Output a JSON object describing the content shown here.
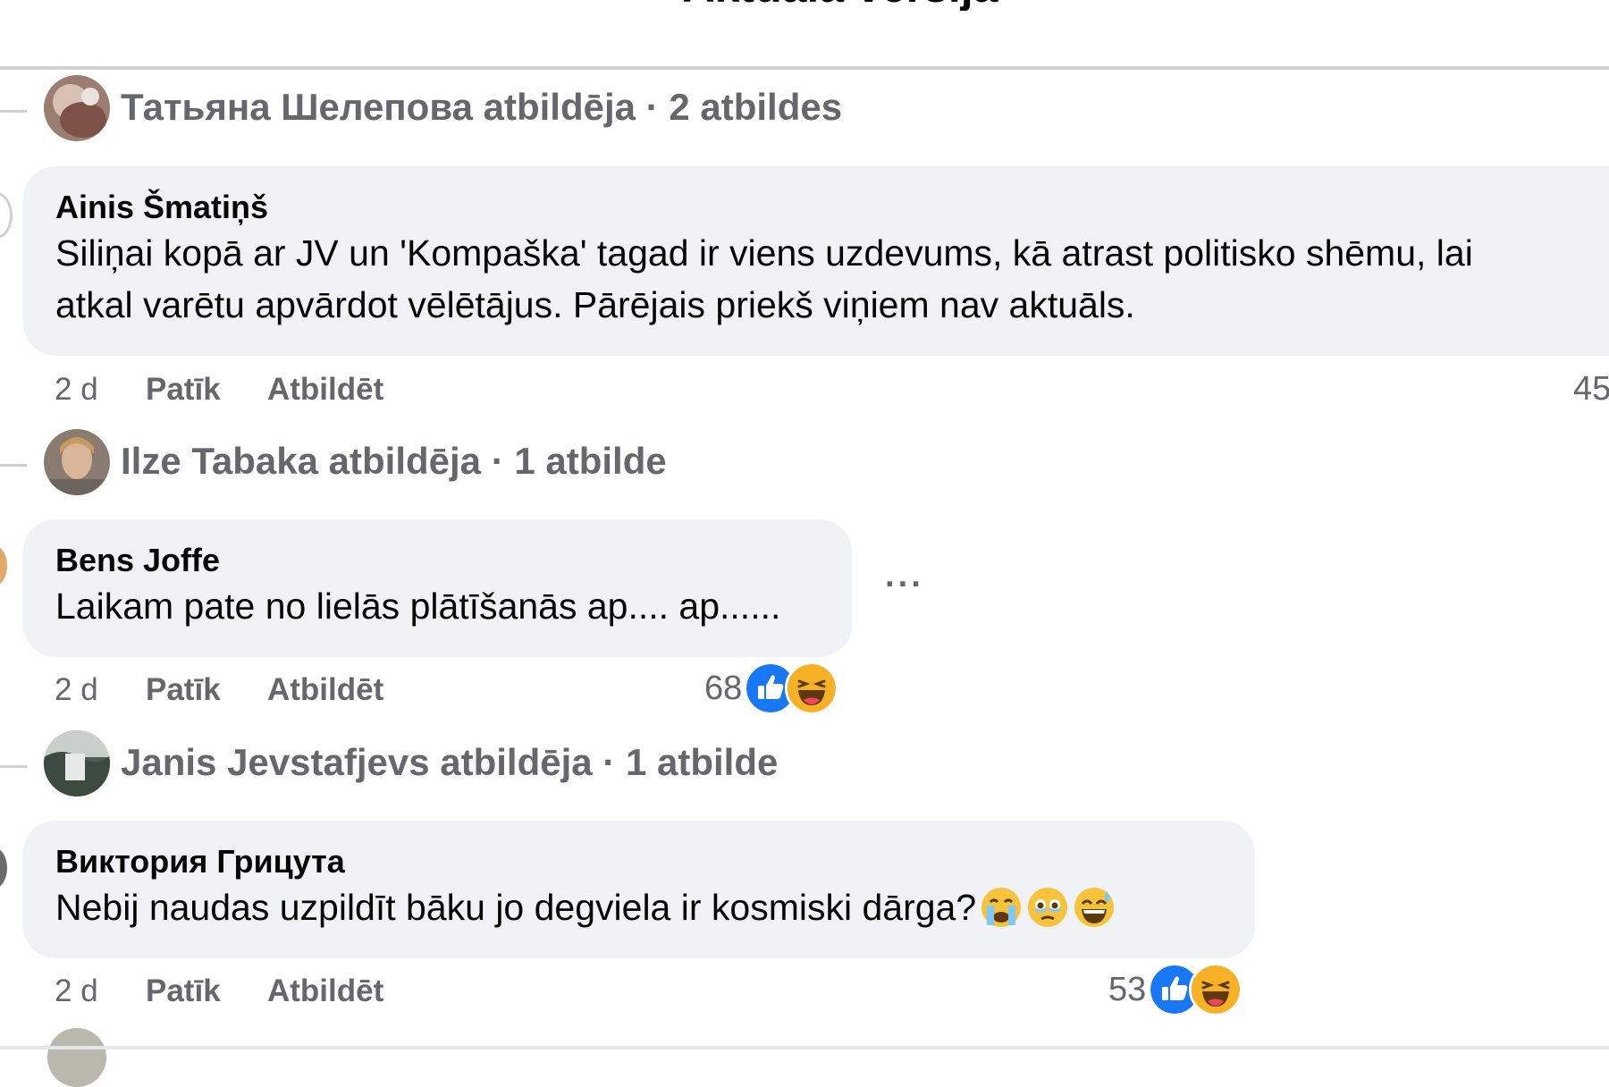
{
  "page": {
    "title": "Aktuālā versija"
  },
  "threads": [
    {
      "reply_summary": "Татьяна Шелепова atbildēja · 2 atbildes",
      "comment": {
        "author": "Ainis Šmatiņš",
        "text_line1": "Siliņai kopā ar JV un 'Kompaška' tagad ir viens uzdevums, kā atrast politisko shēmu, lai",
        "text_line2": "atkal varētu apvārdot vēlētājus. Pārējais priekš viņiem nav aktuāls.",
        "time": "2 d",
        "like_label": "Patīk",
        "reply_label": "Atbildēt",
        "reaction_count": "45"
      }
    },
    {
      "reply_summary": "Ilze Tabaka atbildēja · 1 atbilde",
      "comment": {
        "author": "Bens Joffe",
        "text_line1": "Laikam pate no lielās plātīšanās ap.... ap......",
        "time": "2 d",
        "like_label": "Patīk",
        "reply_label": "Atbildēt",
        "reaction_count": "68",
        "more_label": "···",
        "reactions": [
          "like-icon",
          "haha-icon"
        ]
      }
    },
    {
      "reply_summary": "Janis Jevstafjevs atbildēja · 1 atbilde",
      "comment": {
        "author": "Виктория Грицута",
        "text_line1": "Nebij naudas uzpildīt bāku jo degviela ir kosmiski dārga?",
        "emojis": [
          "crying-face-emoji",
          "face-holding-back-tears-emoji",
          "grinning-sweat-emoji"
        ],
        "time": "2 d",
        "like_label": "Patīk",
        "reply_label": "Atbildēt",
        "reaction_count": "53",
        "reactions": [
          "like-icon",
          "haha-icon"
        ]
      }
    }
  ],
  "colors": {
    "bubble_bg": "#f0f2f5",
    "secondary_text": "#65676b",
    "primary_text": "#050505",
    "like_blue": "#1877f2",
    "haha_yellow": "#f7b125"
  }
}
